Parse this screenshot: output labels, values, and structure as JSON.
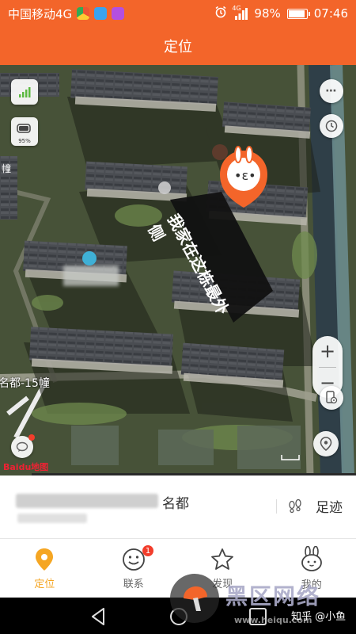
{
  "status_bar": {
    "carrier": "中国移动4G",
    "network": "4G",
    "battery": "98%",
    "battery_level": 0.98,
    "time": "07:46"
  },
  "header": {
    "title": "定位"
  },
  "map": {
    "annotation_text": "我家在这栋最外侧",
    "street_label": "名都-15幢",
    "left_edge_label": "幢",
    "device_battery": "95%",
    "attribution": "Baidu地图"
  },
  "location_card": {
    "address_suffix": "名都",
    "footprint_label": "足迹"
  },
  "tabs": [
    {
      "label": "定位",
      "active": true
    },
    {
      "label": "联系",
      "badge": "1"
    },
    {
      "label": "发现"
    },
    {
      "label": "我的"
    }
  ],
  "watermark": {
    "site": "黑区网络",
    "url": "www.heiqu.com",
    "credit": "知乎 @小鱼"
  },
  "colors": {
    "brand_orange": "#f3652a",
    "active_tab": "#f5a623",
    "badge_red": "#f23d2b"
  }
}
